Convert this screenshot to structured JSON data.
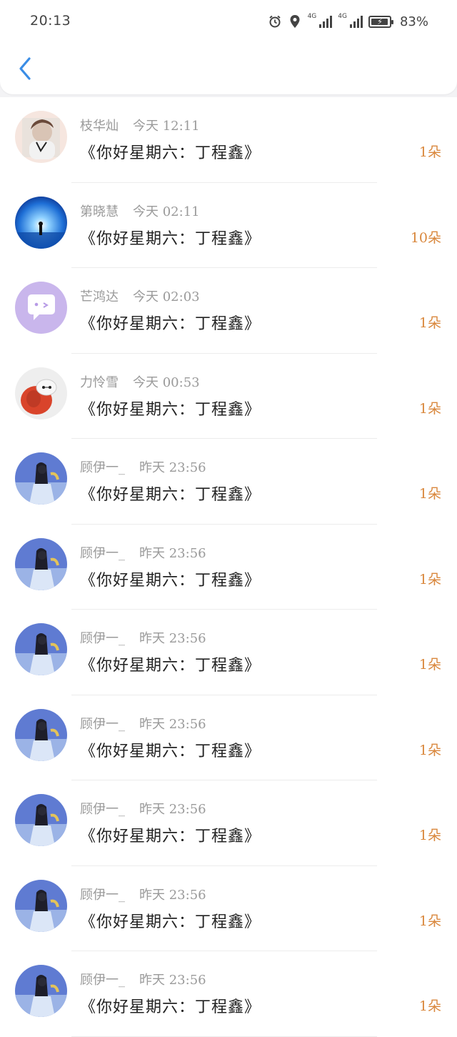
{
  "status_bar": {
    "time": "20:13",
    "network_1": "4G",
    "network_2": "4G",
    "battery": "83%"
  },
  "header": {
    "back_icon": "chevron-left-icon",
    "accent_color": "#3a8de6"
  },
  "messages": [
    {
      "user": "枝华灿",
      "time": "今天 12:11",
      "text": "《你好星期六：丁程鑫》",
      "count": "1朵",
      "avatar": "photo-girl"
    },
    {
      "user": "第晓慧",
      "time": "今天 02:11",
      "text": "《你好星期六：丁程鑫》",
      "count": "10朵",
      "avatar": "night-sky"
    },
    {
      "user": "芒鸿达",
      "time": "今天 02:03",
      "text": "《你好星期六：丁程鑫》",
      "count": "1朵",
      "avatar": "chat-bubble"
    },
    {
      "user": "力怜雪",
      "time": "今天 00:53",
      "text": "《你好星期六：丁程鑫》",
      "count": "1朵",
      "avatar": "robot"
    },
    {
      "user": "顾伊一_",
      "time": "昨天 23:56",
      "text": "《你好星期六：丁程鑫》",
      "count": "1朵",
      "avatar": "girl-blue"
    },
    {
      "user": "顾伊一_",
      "time": "昨天 23:56",
      "text": "《你好星期六：丁程鑫》",
      "count": "1朵",
      "avatar": "girl-blue"
    },
    {
      "user": "顾伊一_",
      "time": "昨天 23:56",
      "text": "《你好星期六：丁程鑫》",
      "count": "1朵",
      "avatar": "girl-blue"
    },
    {
      "user": "顾伊一_",
      "time": "昨天 23:56",
      "text": "《你好星期六：丁程鑫》",
      "count": "1朵",
      "avatar": "girl-blue"
    },
    {
      "user": "顾伊一_",
      "time": "昨天 23:56",
      "text": "《你好星期六：丁程鑫》",
      "count": "1朵",
      "avatar": "girl-blue"
    },
    {
      "user": "顾伊一_",
      "time": "昨天 23:56",
      "text": "《你好星期六：丁程鑫》",
      "count": "1朵",
      "avatar": "girl-blue"
    },
    {
      "user": "顾伊一_",
      "time": "昨天 23:56",
      "text": "《你好星期六：丁程鑫》",
      "count": "1朵",
      "avatar": "girl-blue"
    }
  ]
}
